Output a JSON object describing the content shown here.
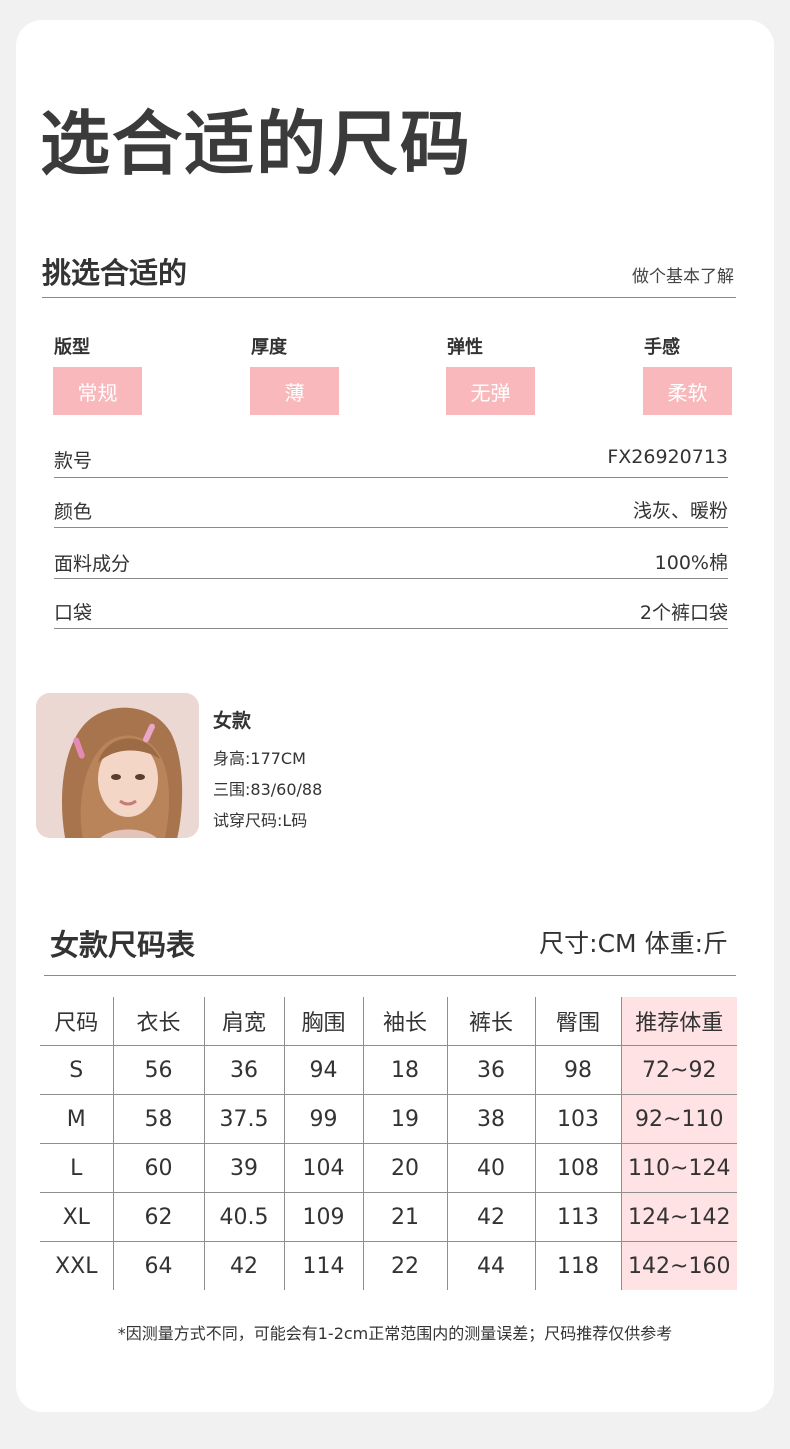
{
  "header": {
    "title": "选合适的尺码"
  },
  "section": {
    "title": "挑选合适的",
    "link": "做个基本了解"
  },
  "attributes": [
    {
      "label": "版型",
      "value": "常规"
    },
    {
      "label": "厚度",
      "value": "薄"
    },
    {
      "label": "弹性",
      "value": "无弹"
    },
    {
      "label": "手感",
      "value": "柔软"
    }
  ],
  "details": [
    {
      "label": "款号",
      "value": "FX26920713"
    },
    {
      "label": "颜色",
      "value": "浅灰、暖粉"
    },
    {
      "label": "面料成分",
      "value": "100%棉"
    },
    {
      "label": "口袋",
      "value": "2个裤口袋"
    }
  ],
  "model": {
    "title": "女款",
    "height": "身高:177CM",
    "measurements": "三围:83/60/88",
    "size": "试穿尺码:L码"
  },
  "size_table": {
    "title": "女款尺码表",
    "unit": "尺寸:CM 体重:斤",
    "headers": [
      "尺码",
      "衣长",
      "肩宽",
      "胸围",
      "袖长",
      "裤长",
      "臀围",
      "推荐体重"
    ],
    "rows": [
      [
        "S",
        "56",
        "36",
        "94",
        "18",
        "36",
        "98",
        "72~92"
      ],
      [
        "M",
        "58",
        "37.5",
        "99",
        "19",
        "38",
        "103",
        "92~110"
      ],
      [
        "L",
        "60",
        "39",
        "104",
        "20",
        "40",
        "108",
        "110~124"
      ],
      [
        "XL",
        "62",
        "40.5",
        "109",
        "21",
        "42",
        "113",
        "124~142"
      ],
      [
        "XXL",
        "64",
        "42",
        "114",
        "22",
        "44",
        "118",
        "142~160"
      ]
    ]
  },
  "footnote": "*因测量方式不同，可能会有1-2cm正常范围内的测量误差；尺码推荐仅供参考",
  "colors": {
    "chip": "#f9b9bc",
    "highlight_column": "#ffe2e3",
    "card": "#ffffff",
    "background": "#f1f1f1"
  }
}
